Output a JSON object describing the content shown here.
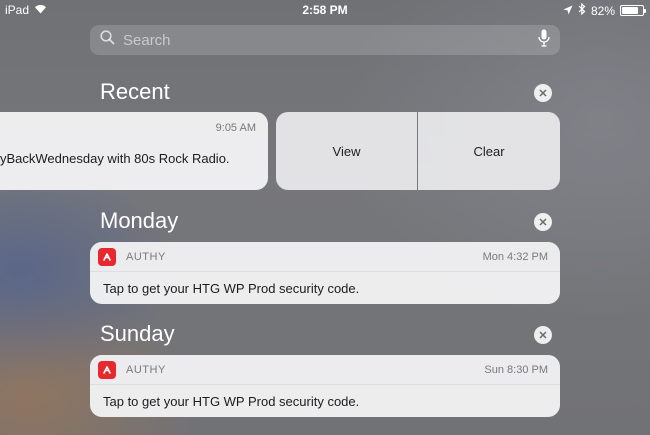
{
  "status_bar": {
    "device": "iPad",
    "time": "2:58 PM",
    "battery": "82%",
    "battery_level": 0.82
  },
  "search": {
    "placeholder": "Search"
  },
  "sections": [
    {
      "title": "Recent",
      "notification": {
        "time": "9:05 AM",
        "message": "yBackWednesday with 80s Rock Radio."
      },
      "actions": {
        "view": "View",
        "clear": "Clear"
      }
    },
    {
      "title": "Monday",
      "notification": {
        "app": "AUTHY",
        "time": "Mon 4:32 PM",
        "message": "Tap to get your HTG WP Prod security code."
      }
    },
    {
      "title": "Sunday",
      "notification": {
        "app": "AUTHY",
        "time": "Sun 8:30 PM",
        "message": "Tap to get your HTG WP Prod security code."
      }
    }
  ],
  "colors": {
    "authy_red": "#e5292f",
    "card_bg": "#f6f6f7"
  }
}
